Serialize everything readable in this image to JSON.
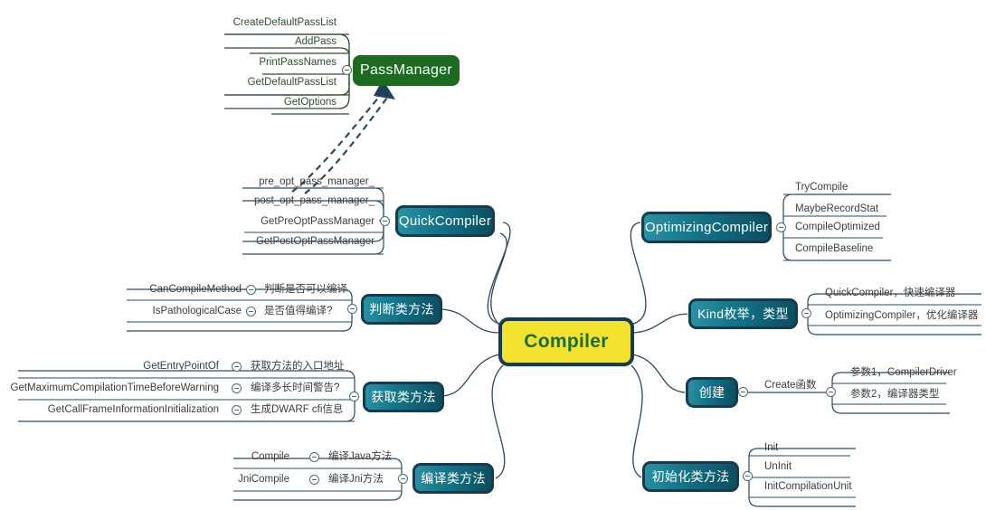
{
  "diagram": {
    "title": "Compiler",
    "colors": {
      "center_fill": "#f2e32e",
      "center_text": "#1f6b38",
      "branch_fill": "#15778b",
      "branch_border": "#153a52",
      "green_node": "#1d6b20",
      "line": "#2b4a63",
      "green_line": "#2e4d2e",
      "leaf_text": "#3d3d3d"
    },
    "center": {
      "label": "Compiler"
    },
    "special_node": {
      "label": "PassManager",
      "note_icon": "dashed-arrow-icon"
    },
    "pass_manager_children": [
      {
        "label": "CreateDefaultPassList"
      },
      {
        "label": "AddPass"
      },
      {
        "label": "PrintPassNames"
      },
      {
        "label": "GetDefaultPassList"
      },
      {
        "label": "GetOptions"
      }
    ],
    "branches": [
      {
        "id": "quick-compiler",
        "label": "QuickCompiler",
        "side": "left",
        "children": [
          {
            "label": "pre_opt_pass_manager_"
          },
          {
            "label": "post_opt_pass_manager_"
          },
          {
            "label": "GetPreOptPassManager"
          },
          {
            "label": "GetPostOptPassManager"
          }
        ]
      },
      {
        "id": "optimizing-compiler",
        "label": "OptimizingCompiler",
        "side": "right",
        "children": [
          {
            "label": "TryCompile"
          },
          {
            "label": "MaybeRecordStat"
          },
          {
            "label": "CompileOptimized"
          },
          {
            "label": "CompileBaseline"
          }
        ]
      },
      {
        "id": "judge-methods",
        "label": "判断类方法",
        "side": "left",
        "children": [
          {
            "label": "CanCompileMethod",
            "note": "判断是否可以编译"
          },
          {
            "label": "IsPathologicalCase",
            "note": "是否值得编译?"
          }
        ]
      },
      {
        "id": "get-methods",
        "label": "获取类方法",
        "side": "left",
        "children": [
          {
            "label": "GetEntryPointOf",
            "note": "获取方法的入口地址"
          },
          {
            "label": "GetMaximumCompilationTimeBeforeWarning",
            "note": "编译多长时间警告?"
          },
          {
            "label": "GetCallFrameInformationInitialization",
            "note": "生成DWARF cfi信息"
          }
        ]
      },
      {
        "id": "compile-methods",
        "label": "编译类方法",
        "side": "left",
        "children": [
          {
            "label": "Compile",
            "note": "编译Java方法"
          },
          {
            "label": "JniCompile",
            "note": "编译Jni方法"
          }
        ]
      },
      {
        "id": "kind-enum",
        "label": "Kind枚举，类型",
        "side": "right",
        "children": [
          {
            "label": "QuickCompiler，快速编译器"
          },
          {
            "label": "OptimizingCompiler，优化编译器"
          }
        ]
      },
      {
        "id": "create",
        "label": "创建",
        "side": "right",
        "children": [
          {
            "label": "Create函数",
            "children": [
              {
                "label": "参数1，CompilerDriver"
              },
              {
                "label": "参数2，编译器类型"
              }
            ]
          }
        ]
      },
      {
        "id": "init-methods",
        "label": "初始化类方法",
        "side": "right",
        "children": [
          {
            "label": "Init"
          },
          {
            "label": "UnInit"
          },
          {
            "label": "InitCompilationUnit"
          }
        ]
      }
    ]
  }
}
